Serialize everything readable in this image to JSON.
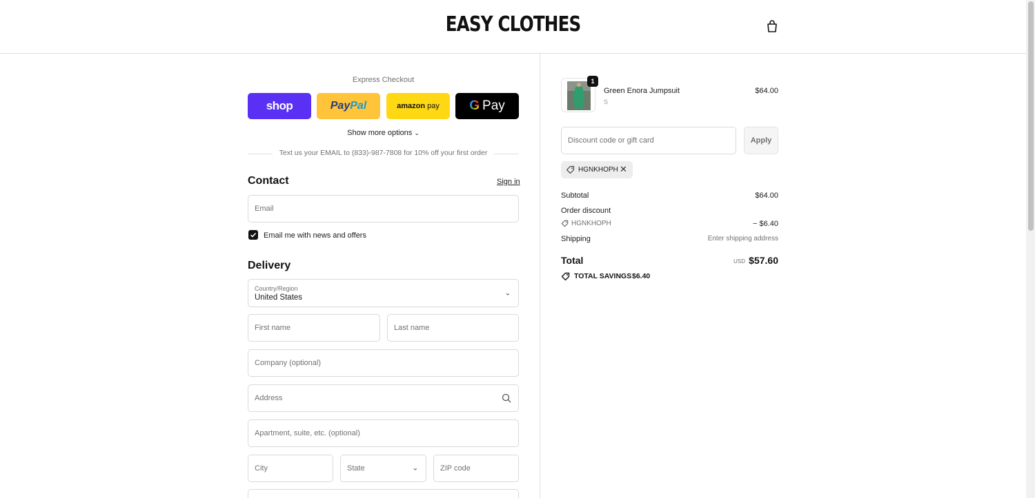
{
  "header": {
    "brand": "EASY CLOTHES",
    "cart_icon": "shopping-bag-icon"
  },
  "express": {
    "title": "Express Checkout",
    "buttons": [
      {
        "name": "shop",
        "label": "shop",
        "color": "#5a31f4"
      },
      {
        "name": "paypal",
        "label_1": "Pay",
        "label_2": "Pal",
        "color": "#ffc439"
      },
      {
        "name": "amazon",
        "label_1": "amazon",
        "label_2": "pay",
        "color": "#ffd814"
      },
      {
        "name": "gpay",
        "label_1": "G",
        "label_2": "Pay",
        "color": "#000000"
      }
    ],
    "show_more": "Show more options",
    "sms_promo": "Text us your EMAIL to (833)-987-7808 for 10% off your first order"
  },
  "contact": {
    "title": "Contact",
    "sign_in": "Sign in",
    "email_placeholder": "Email",
    "newsletter_label": "Email me with news and offers",
    "newsletter_checked": true
  },
  "delivery": {
    "title": "Delivery",
    "country_label": "Country/Region",
    "country_value": "United States",
    "first_name_placeholder": "First name",
    "last_name_placeholder": "Last name",
    "company_placeholder": "Company (optional)",
    "address_placeholder": "Address",
    "apartment_placeholder": "Apartment, suite, etc. (optional)",
    "city_placeholder": "City",
    "state_placeholder": "State",
    "zip_placeholder": "ZIP code"
  },
  "order": {
    "item": {
      "name": "Green Enora Jumpsuit",
      "variant": "S",
      "price": "$64.00",
      "quantity": "1"
    },
    "discount_placeholder": "Discount code or gift card",
    "apply_label": "Apply",
    "applied_code": "HGNKHOPH",
    "subtotal_label": "Subtotal",
    "subtotal_value": "$64.00",
    "order_discount_label": "Order discount",
    "discount_code": "HGNKHOPH",
    "discount_value": "− $6.40",
    "shipping_label": "Shipping",
    "shipping_value": "Enter shipping address",
    "total_label": "Total",
    "total_currency": "USD",
    "total_value": "$57.60",
    "savings_label": "TOTAL SAVINGS",
    "savings_value": "$6.40"
  }
}
